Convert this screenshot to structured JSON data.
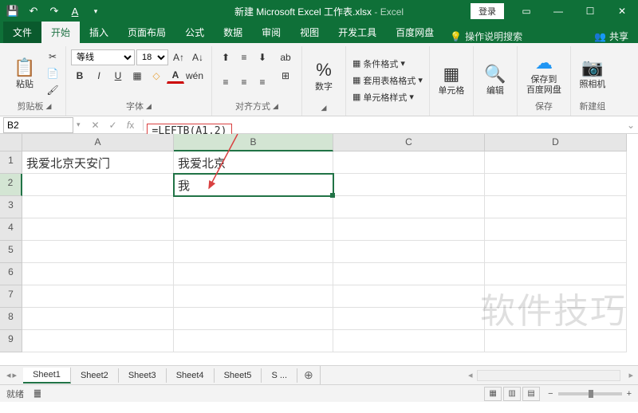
{
  "title": {
    "doc": "新建 Microsoft Excel 工作表.xlsx",
    "app": "Excel",
    "login": "登录"
  },
  "tabs": {
    "file": "文件",
    "home": "开始",
    "insert": "插入",
    "layout": "页面布局",
    "formula": "公式",
    "data": "数据",
    "review": "审阅",
    "view": "视图",
    "dev": "开发工具",
    "baidu": "百度网盘",
    "tellme": "操作说明搜索",
    "share": "共享"
  },
  "ribbon": {
    "clipboard": {
      "paste": "粘贴",
      "label": "剪贴板"
    },
    "font": {
      "name": "等线",
      "size": "18",
      "label": "字体"
    },
    "align": {
      "wrap": "ab",
      "label": "对齐方式"
    },
    "number": {
      "btn": "%",
      "label": "数字"
    },
    "styles": {
      "cond": "条件格式",
      "table": "套用表格格式",
      "cell": "单元格样式"
    },
    "cells": {
      "label": "单元格"
    },
    "editing": {
      "label": "编辑"
    },
    "baidu": {
      "save": "保存到",
      "line2": "百度网盘",
      "label": "保存"
    },
    "camera": {
      "btn": "照相机",
      "label": "新建组"
    }
  },
  "formula_bar": {
    "name_box": "B2",
    "formula": "=LEFTB(A1,2)"
  },
  "columns": [
    "A",
    "B",
    "C",
    "D"
  ],
  "rows": [
    "1",
    "2",
    "3",
    "4",
    "5",
    "6",
    "7",
    "8",
    "9"
  ],
  "cells": {
    "A1": "我爱北京天安门",
    "B1": "我爱北京",
    "B2": "我"
  },
  "sheets": {
    "nav": [
      "◂",
      "▸"
    ],
    "list": [
      "Sheet1",
      "Sheet2",
      "Sheet3",
      "Sheet4",
      "Sheet5"
    ],
    "overflow": "S ...",
    "new": "⊕"
  },
  "status": {
    "ready": "就绪",
    "calc": "䷀",
    "zoom": ""
  },
  "watermark": "软件技巧"
}
